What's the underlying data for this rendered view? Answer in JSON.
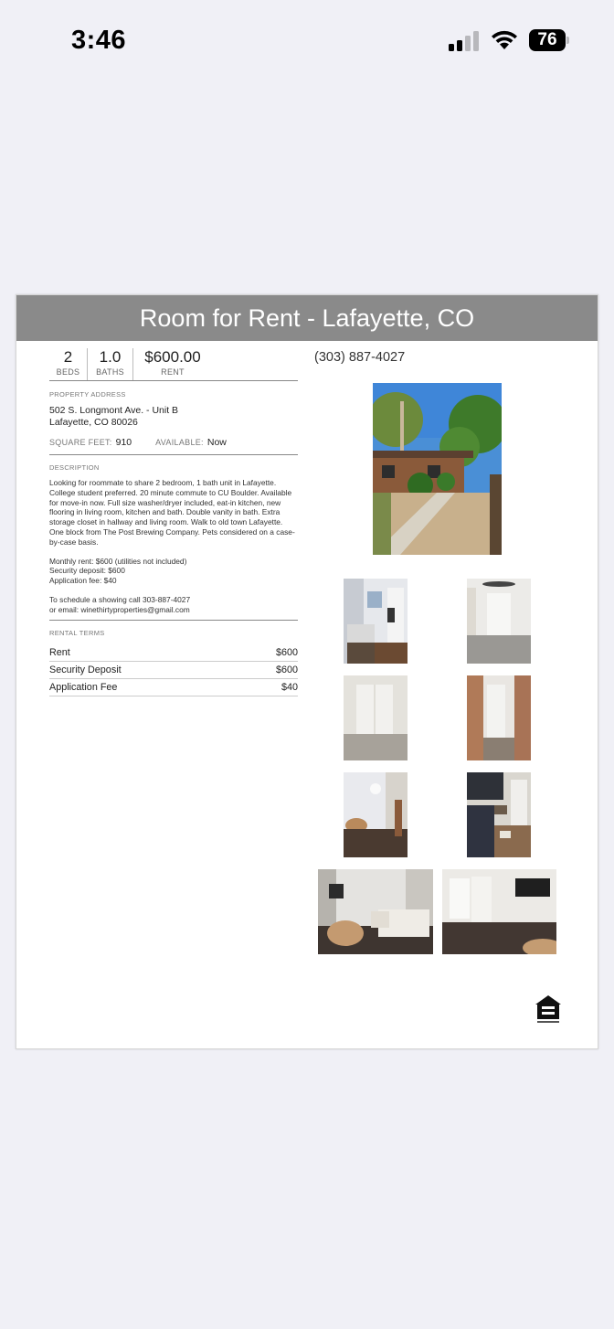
{
  "status": {
    "time": "3:46",
    "battery": "76"
  },
  "listing": {
    "title": "Room for Rent - Lafayette, CO",
    "beds_value": "2",
    "beds_label": "BEDS",
    "baths_value": "1.0",
    "baths_label": "BATHS",
    "rent_value": "$600.00",
    "rent_label": "RENT",
    "phone": "(303) 887-4027",
    "address_label": "PROPERTY ADDRESS",
    "address_line1": "502 S. Longmont Ave. - Unit B",
    "address_line2": "Lafayette, CO 80026",
    "sqft_label": "SQUARE FEET:",
    "sqft_value": "910",
    "available_label": "AVAILABLE:",
    "available_value": "Now",
    "description_label": "DESCRIPTION",
    "description_p1": "Looking for roommate to share 2 bedroom, 1 bath unit in Lafayette. College student preferred. 20 minute commute to CU Boulder. Available for move-in now. Full size washer/dryer included, eat-in kitchen, new flooring in living room, kitchen and bath. Double vanity in bath. Extra storage closet in hallway and living room. Walk to old town Lafayette. One block from The Post Brewing Company. Pets considered on a case-by-case basis.",
    "description_p2_l1": "Monthly rent: $600 (utilities not included)",
    "description_p2_l2": "Security deposit: $600",
    "description_p2_l3": "Application fee: $40",
    "description_p3_l1": "To schedule a showing call 303-887-4027",
    "description_p3_l2": "or email: winethirtyproperties@gmail.com",
    "terms_label": "RENTAL TERMS",
    "terms": [
      {
        "name": "Rent",
        "value": "$600"
      },
      {
        "name": "Security Deposit",
        "value": "$600"
      },
      {
        "name": "Application Fee",
        "value": "$40"
      }
    ]
  }
}
